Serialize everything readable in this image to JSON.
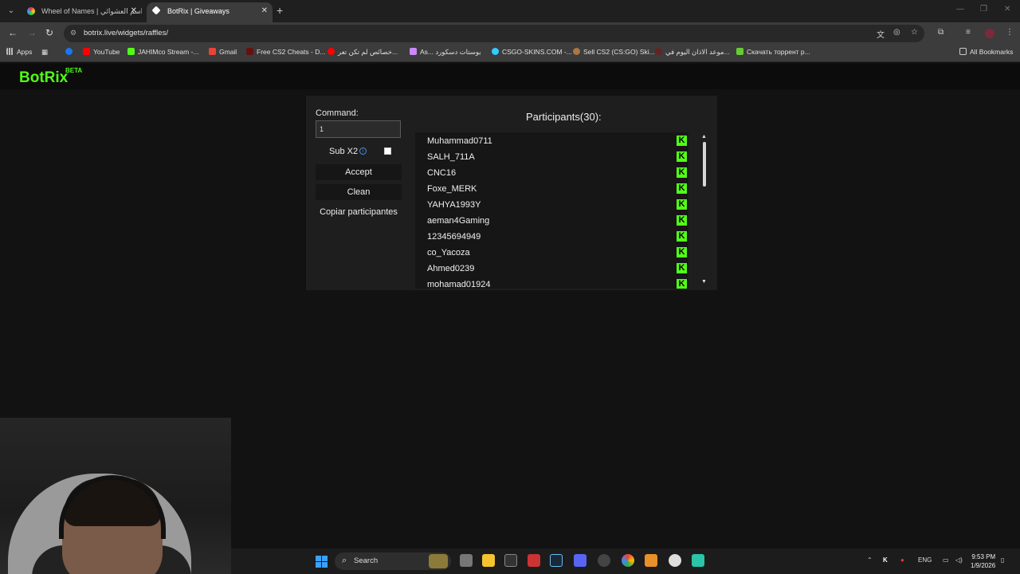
{
  "browser": {
    "tabs": [
      {
        "title": "Wheel of Names | اسم العشوائي",
        "active": false
      },
      {
        "title": "BotRix | Giveaways",
        "active": true
      }
    ],
    "url": "botrix.live/widgets/raffles/",
    "bookmarks": [
      "Apps",
      "YouTube",
      "JAHIMco Stream -...",
      "Gmail",
      "Free CS2 Cheats - D...",
      "خصائص لم تكن تعر...",
      "As... بوستات دسكورد",
      "CSGO-SKINS.COM -...",
      "Sell CS2 (CS:GO) Ski...",
      "موعد الاذان اليوم في...",
      "Скачать торрент р..."
    ],
    "all_bookmarks": "All Bookmarks"
  },
  "site": {
    "logo": "BotRix",
    "badge": "BETA"
  },
  "raffle": {
    "command_label": "Command:",
    "command_value": "1",
    "sub_label": "Sub X2",
    "sub_checked": false,
    "accept": "Accept",
    "clean": "Clean",
    "copy": "Copiar participantes",
    "participants_title": "Participants(30):",
    "participants": [
      "Muhammad0711",
      "SALH_711A",
      "CNC16",
      "Foxe_MERK",
      "YAHYA1993Y",
      "aeman4Gaming",
      "12345694949",
      "co_Yacoza",
      "Ahmed0239",
      "mohamad01924"
    ],
    "platform_icon": "kick-icon",
    "accent": "#53fc18"
  },
  "taskbar": {
    "search": "Search",
    "lang": "ENG",
    "time": "9:53 PM",
    "date": "1/9/2026"
  }
}
